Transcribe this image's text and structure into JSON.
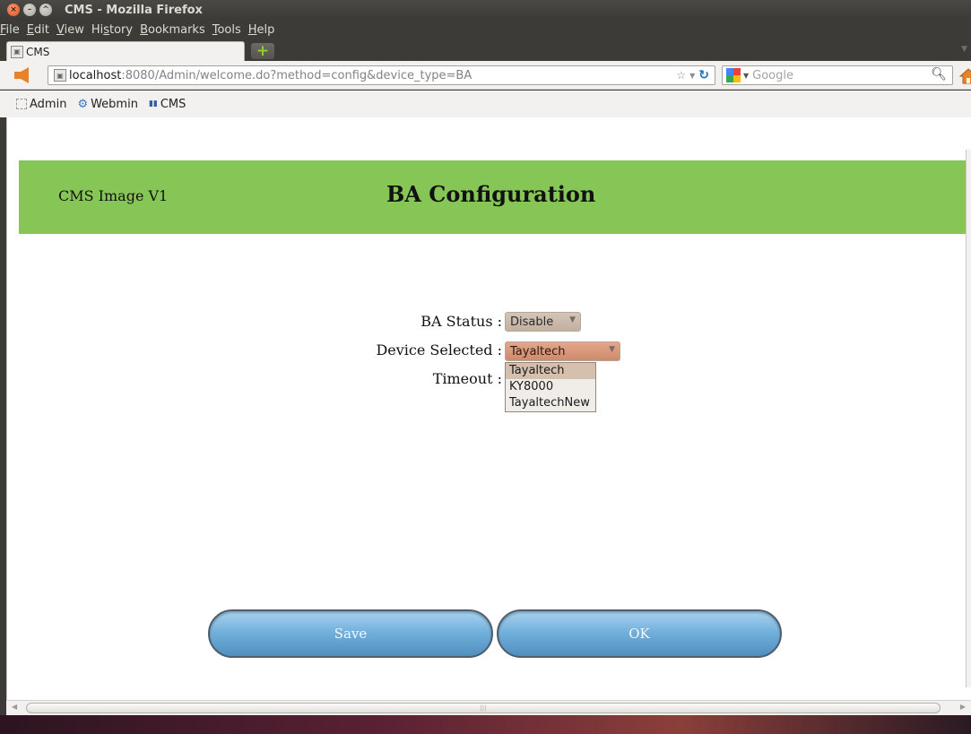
{
  "window": {
    "title": "CMS - Mozilla Firefox"
  },
  "menu": {
    "items": [
      {
        "key": "F",
        "rest": "ile"
      },
      {
        "key": "E",
        "rest": "dit"
      },
      {
        "key": "V",
        "rest": "iew"
      },
      {
        "pre": "Hi",
        "key": "s",
        "rest": "tory"
      },
      {
        "key": "B",
        "rest": "ookmarks"
      },
      {
        "key": "T",
        "rest": "ools"
      },
      {
        "key": "H",
        "rest": "elp"
      }
    ]
  },
  "tab": {
    "label": "CMS"
  },
  "nav": {
    "url_host": "localhost",
    "url_rest": ":8080/Admin/welcome.do?method=config&device_type=BA",
    "search_placeholder": "Google"
  },
  "bookmarks": {
    "items": [
      "Admin",
      "Webmin",
      "CMS"
    ]
  },
  "page": {
    "header_left": "CMS Image V1",
    "header_title": "BA Configuration",
    "form": {
      "ba_status_label": "BA Status :",
      "ba_status_value": "Disable",
      "device_label": "Device Selected :",
      "device_value": "Tayaltech",
      "timeout_label": "Timeout :",
      "device_options": [
        "Tayaltech",
        "KY8000",
        "TayaltechNew"
      ]
    },
    "buttons": {
      "save": "Save",
      "ok": "OK"
    }
  },
  "colors": {
    "header_bg": "#86c656",
    "button_blue": "#74b1dc"
  },
  "icons": [
    "close-icon",
    "minimize-icon",
    "maximize-icon",
    "new-tab-icon",
    "back-arrow-icon",
    "star-icon",
    "reload-icon",
    "google-icon",
    "search-icon",
    "home-icon",
    "webmin-icon",
    "cms-icon"
  ]
}
